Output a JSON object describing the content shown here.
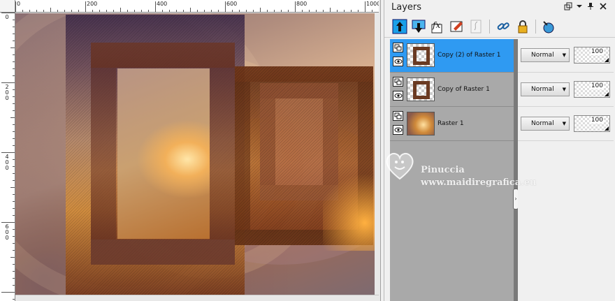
{
  "rulers": {
    "top_labels": [
      "0",
      "200",
      "400",
      "600",
      "800",
      "1000"
    ],
    "left_labels": [
      "0",
      "2\n0\n0",
      "4\n0\n0",
      "6\n0\n0"
    ]
  },
  "layers_panel": {
    "title": "Layers",
    "titlebar_buttons": [
      "restore",
      "dropdown",
      "pin",
      "close"
    ],
    "toolbar": [
      "move-layer-up",
      "move-layer-down",
      "add-effect",
      "edit-selection",
      "vector-layer",
      "link",
      "lock",
      "mask"
    ],
    "layers": [
      {
        "name": "Copy (2) of Raster 1",
        "selected": true,
        "thumb": "frame",
        "blend_mode": "Normal",
        "opacity": "100"
      },
      {
        "name": "Copy of Raster 1",
        "selected": false,
        "thumb": "frame",
        "blend_mode": "Normal",
        "opacity": "100"
      },
      {
        "name": "Raster 1",
        "selected": false,
        "thumb": "raster",
        "blend_mode": "Normal",
        "opacity": "100"
      }
    ]
  },
  "watermark": {
    "name": "Pinuccia",
    "url": "www.maidiregrafica.eu"
  },
  "colors": {
    "selection": "#2f9af2",
    "panel_bg": "#f0f0f0",
    "list_bg": "#a9a9a9"
  }
}
